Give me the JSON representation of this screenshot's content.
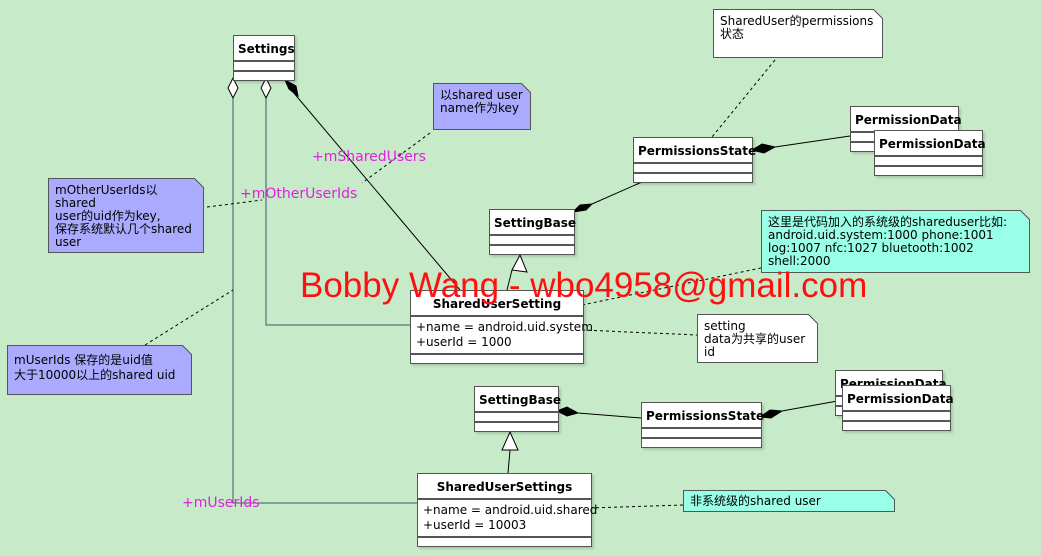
{
  "classes": {
    "settings": {
      "title": "Settings"
    },
    "permissions_state_1": {
      "title": "PermissionsState"
    },
    "permission_data_1a": {
      "title": "PermissionData"
    },
    "permission_data_1b": {
      "title": "PermissionData"
    },
    "setting_base_1": {
      "title": "SettingBase"
    },
    "shared_user_setting": {
      "title": "SharedUserSetting",
      "attrs": [
        "+name = android.uid.system",
        "+userId = 1000"
      ]
    },
    "setting_base_2": {
      "title": "SettingBase"
    },
    "permissions_state_2": {
      "title": "PermissionsState"
    },
    "permission_data_2a": {
      "title": "PermissionData"
    },
    "permission_data_2b": {
      "title": "PermissionData"
    },
    "shared_user_settings": {
      "title": "SharedUserSettings",
      "attrs": [
        "+name = android.uid.shared",
        "+userId = 10003"
      ]
    }
  },
  "roles": {
    "shared_users": "+mSharedUsers",
    "other_user_ids": "+mOtherUserIds",
    "user_ids": "+mUserIds"
  },
  "notes": {
    "shared_user_key": [
      "以shared user",
      "name作为key"
    ],
    "other_user_ids": [
      "mOtherUserIds以 shared",
      "user的uid作为key,",
      "保存系统默认几个shared",
      "user"
    ],
    "user_ids": [
      "mUserIds 保存的是uid值",
      "大于10000以上的shared uid"
    ],
    "permissions": [
      "SharedUser的permissions",
      "状态"
    ],
    "system_shared_users": [
      "这里是代码加入的系统级的shareduser比如:",
      "android.uid.system:1000 phone:1001",
      "log:1007 nfc:1027 bluetooth:1002",
      "shell:2000"
    ],
    "setting_data": [
      "setting",
      "data为共享的user",
      "id"
    ],
    "non_system": [
      "非系统级的shared user"
    ]
  },
  "watermark": "Bobby Wang - wbo4958@gmail.com",
  "colors": {
    "background": "#c7ebc9",
    "note_purple": "#aaaaff",
    "note_cyan": "#99ffe6",
    "role_label": "#e020e0",
    "watermark": "#ff1010"
  }
}
